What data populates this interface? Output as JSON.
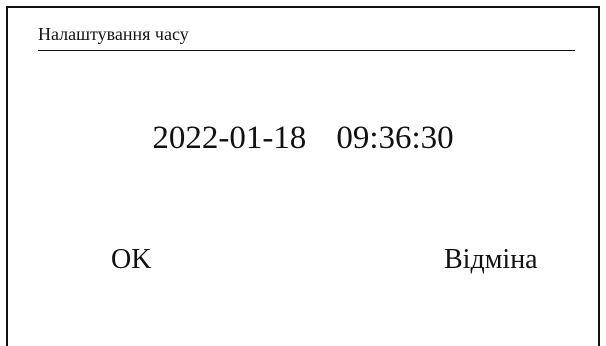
{
  "dialog": {
    "title": "Налаштування часу",
    "date": "2022-01-18",
    "time": "09:36:30",
    "ok_label": "OK",
    "cancel_label": "Відміна"
  }
}
